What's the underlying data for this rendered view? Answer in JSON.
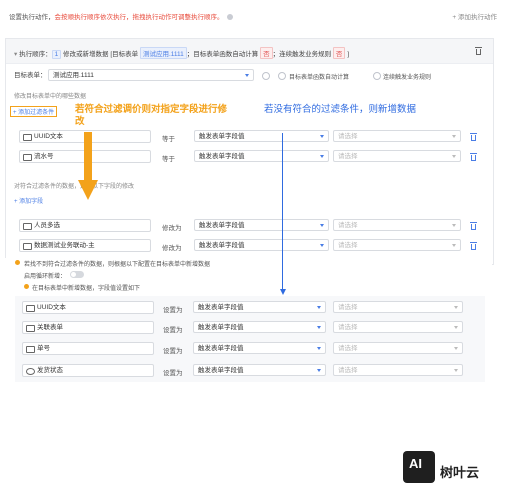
{
  "topbar": {
    "hint_prefix": "设置执行动作，",
    "hint_red": "会按顺执行顺序依次执行，拖拽执行动作可调整执行顺序。",
    "add_action": "+ 添加执行动作"
  },
  "panel": {
    "exec_order_label": "执行顺序：",
    "exec_order_value": "1",
    "action_label": "修改或新增数据",
    "target_label": "[目标表单",
    "target_value": "测试应用.1111",
    "trigger_label": "；目标表单函数自动计算",
    "trigger_value": "否",
    "rule_label": "；连续触发业务规则",
    "rule_value": "否",
    "end_bracket": "]",
    "target_form_label": "目标表单：",
    "target_form_value": "测试应用.1111",
    "opt_auto_calc": "目标表单函数自动计算",
    "opt_continuous": "连续触发业务规则",
    "modify_hint": "修改目标表单中的哪些数据",
    "add_filter": "+ 添加过滤条件",
    "filters": [
      {
        "field": "UUID文本",
        "op": "等于",
        "value": "触发表单字段值",
        "target": "请选择"
      },
      {
        "field": "流水号",
        "op": "等于",
        "value": "触发表单字段值",
        "target": "请选择"
      }
    ],
    "update_hint": "对符合过滤条件的数据，进行以下字段的修改",
    "add_field": "+ 添加字段",
    "updates": [
      {
        "field": "人员多选",
        "op": "修改为",
        "value": "触发表单字段值",
        "target": "请选择"
      },
      {
        "field": "数据测试业务联动-主",
        "op": "修改为",
        "value": "触发表单字段值",
        "target": "请选择"
      }
    ]
  },
  "lower": {
    "notice": "若找不到符合过滤条件的数据，则根据以下配置在目标表单中新增数据",
    "loop_label": "启用循环新增：",
    "add_hint": "在目标表单中新增数据，字段值设置如下",
    "rows": [
      {
        "field": "UUID文本",
        "op": "设置为",
        "value": "触发表单字段值",
        "target": "请选择"
      },
      {
        "field": "关联表单",
        "op": "设置为",
        "value": "触发表单字段值",
        "target": "请选择"
      },
      {
        "field": "单号",
        "op": "设置为",
        "value": "触发表单字段值",
        "target": "请选择"
      },
      {
        "field": "发货状态",
        "op": "设置为",
        "value": "触发表单字段值",
        "target": "请选择"
      }
    ]
  },
  "annotations": {
    "orange": "若符合过滤调价则对指定字段进行修改",
    "blue": "若没有符合的过滤条件，则新增数据"
  },
  "watermark": {
    "logo": "AI",
    "name": "树叶云"
  },
  "colors": {
    "accent": "#4a7de5",
    "orange": "#f3a21b",
    "blue_annot": "#2f6be0",
    "danger": "#e05252"
  }
}
